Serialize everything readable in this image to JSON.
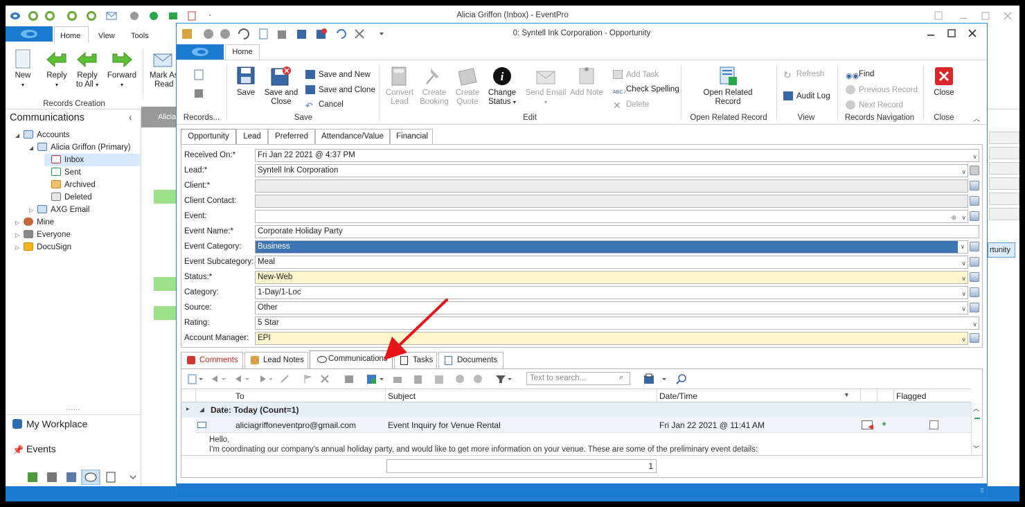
{
  "outer": {
    "title": "Alicia Griffon (Inbox) - EventPro",
    "tabs": [
      "Home",
      "View",
      "Tools"
    ],
    "ribbon": {
      "new": "New",
      "reply": "Reply",
      "reply_all_1": "Reply",
      "reply_all_2": "to All",
      "forward": "Forward",
      "mark_as_1": "Mark As",
      "mark_as_2": "Read",
      "group_label": "Records Creation"
    },
    "sidebar": {
      "title": "Communications",
      "accounts": "Accounts",
      "primary": "Alicia Griffon (Primary)",
      "inbox": "Inbox",
      "sent": "Sent",
      "archived": "Archived",
      "deleted": "Deleted",
      "axg": "AXG Email",
      "mine": "Mine",
      "everyone": "Everyone",
      "docusign": "DocuSign",
      "workplace": "My Workplace",
      "events": "Events",
      "splitter": "......",
      "background_tab": "Alicia",
      "background_btn": "rtunity"
    }
  },
  "dialog": {
    "title": "0: Syntell Ink Corporation - Opportunity",
    "tab": "Home",
    "ribbon": {
      "records": "Records...",
      "save": "Save",
      "save_close_1": "Save and",
      "save_close_2": "Close",
      "save_new": "Save and New",
      "save_clone": "Save and Clone",
      "cancel": "Cancel",
      "save_group": "Save",
      "convert_1": "Convert",
      "convert_2": "Lead",
      "create_booking_1": "Create",
      "create_booking_2": "Booking",
      "create_quote_1": "Create",
      "create_quote_2": "Quote",
      "change_status_1": "Change",
      "change_status_2": "Status",
      "send_email": "Send Email",
      "add_note": "Add Note",
      "add_task": "Add Task",
      "check_spelling": "Check Spelling",
      "delete": "Delete",
      "edit_group": "Edit",
      "open_related_1": "Open Related",
      "open_related_2": "Record",
      "open_related_group": "Open Related Record",
      "refresh": "Refresh",
      "audit_log": "Audit Log",
      "view_group": "View",
      "find": "Find",
      "prev_record": "Previous Record",
      "next_record": "Next Record",
      "nav_group": "Records Navigation",
      "close": "Close",
      "close_group": "Close"
    },
    "form_tabs": [
      "Opportunity",
      "Lead",
      "Preferred",
      "Attendance/Value",
      "Financial"
    ],
    "fields": [
      {
        "label": "Received On:*",
        "value": "Fri Jan 22 2021 @ 4:37 PM"
      },
      {
        "label": "Lead:*",
        "value": "Syntell Ink Corporation"
      },
      {
        "label": "Client:*",
        "value": ""
      },
      {
        "label": "Client Contact:",
        "value": ""
      },
      {
        "label": "Event:",
        "value": ""
      },
      {
        "label": "Event Name:*",
        "value": "Corporate Holiday Party"
      },
      {
        "label": "Event Category:",
        "value": "Business"
      },
      {
        "label": "Event Subcategory:",
        "value": "Meal"
      },
      {
        "label": "Status:*",
        "value": "New-Web"
      },
      {
        "label": "Category:",
        "value": "1-Day/1-Loc"
      },
      {
        "label": "Source:",
        "value": "Other"
      },
      {
        "label": "Rating:",
        "value": "5 Star"
      },
      {
        "label": "Account Manager:",
        "value": "EPI"
      }
    ],
    "bottom_tabs": [
      "Comments",
      "Lead Notes",
      "Communications",
      "Tasks",
      "Documents"
    ],
    "search_placeholder": "Text to search...",
    "grid": {
      "columns": [
        "To",
        "Subject",
        "Date/Time",
        "Flagged"
      ],
      "group_row": "Date: Today (Count=1)",
      "row": {
        "to": "aliciagriffoneventpro@gmail.com",
        "subject": "Event Inquiry for Venue Rental",
        "datetime": "Fri Jan 22 2021 @ 11:41 AM"
      },
      "preview_1": "Hello,",
      "preview_2": "I'm coordinating our company's annual holiday party, and would like to get more information on your venue. These are some of the preliminary event details:",
      "footer_count": "1"
    }
  },
  "colors": {
    "accent": "#1b7bd0",
    "selected_field": "#3d74b3",
    "required_field": "#fdf6cd",
    "arrow": "#e8161b"
  }
}
